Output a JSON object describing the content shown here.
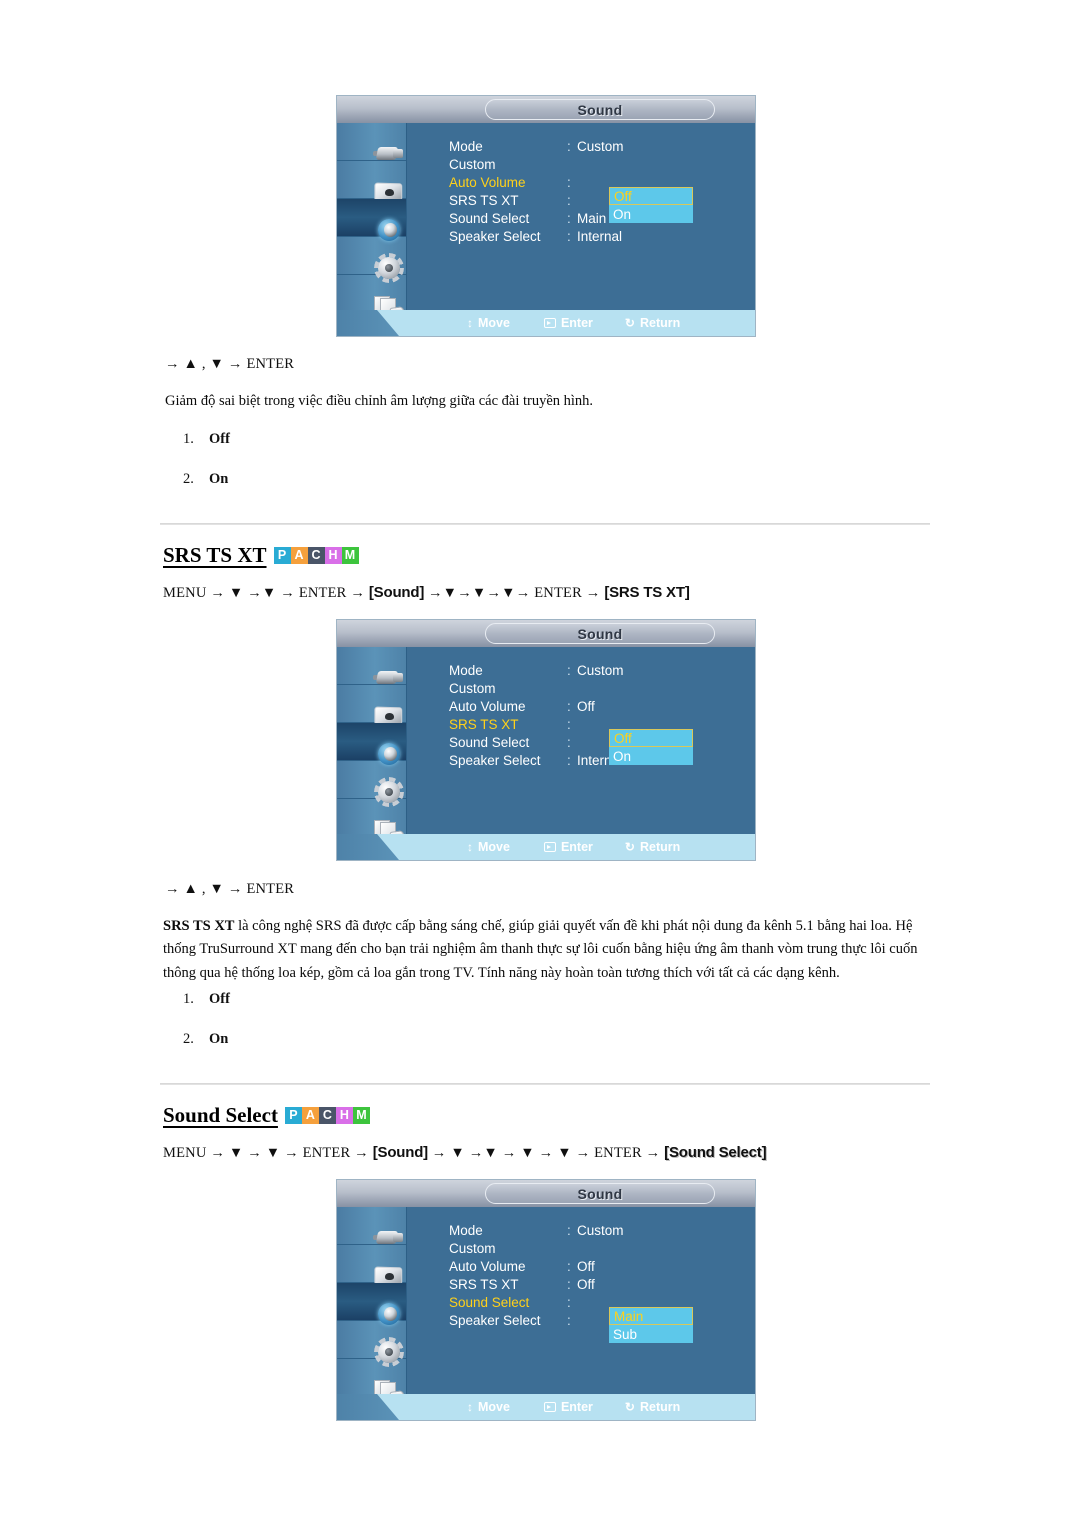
{
  "sections": [
    {
      "nav_after": "→ ▲ , ▼ → ENTER",
      "description": "Giảm độ sai biệt trong việc điều chỉnh âm lượng giữa các đài truyền hình.",
      "options": [
        {
          "num": "1.",
          "value": "Off"
        },
        {
          "num": "2.",
          "value": "On"
        }
      ]
    }
  ],
  "headings": {
    "srs": "SRS TS XT",
    "sound_select": "Sound Select"
  },
  "badges": [
    {
      "letter": "P",
      "color": "#29abd4"
    },
    {
      "letter": "A",
      "color": "#f5a03c"
    },
    {
      "letter": "C",
      "color": "#4a5568"
    },
    {
      "letter": "H",
      "color": "#d96fe8"
    },
    {
      "letter": "M",
      "color": "#3dc43d"
    }
  ],
  "paths": {
    "srs": {
      "prefix": "MENU → ▼ →▼ → ENTER → ",
      "token1": "[Sound]",
      "middle": " →▼→▼→▼→ ENTER → ",
      "token2": "[SRS TS XT]"
    },
    "sound_select": {
      "prefix": "MENU → ▼ → ▼ → ENTER → ",
      "token1": "[Sound]",
      "middle": " → ▼ →▼ → ▼ → ▼ → ENTER → ",
      "token2": "[Sound Select]"
    }
  },
  "nav_enter": "→ ▲ , ▼ → ENTER",
  "srs_description": "SRS TS XT là công nghệ SRS đã được cấp bằng sáng chế, giúp giải quyết vấn đề khi phát nội dung đa kênh 5.1 bằng hai loa. Hệ thống TruSurround XT mang đến cho bạn trải nghiệm âm thanh thực sự lôi cuốn bằng hiệu ứng âm thanh vòm trung thực lôi cuốn thông qua hệ thống loa kép, gồm cả loa gắn trong TV. Tính năng này hoàn toàn tương thích với tất cả các dạng kênh.",
  "srs_description_bold": "SRS TS XT",
  "srs_options": [
    {
      "num": "1.",
      "value": "Off"
    },
    {
      "num": "2.",
      "value": "On"
    }
  ],
  "osd": {
    "title": "Sound",
    "sidebar_icons": [
      {
        "name": "input-source-icon"
      },
      {
        "name": "picture-icon"
      },
      {
        "name": "sound-icon"
      },
      {
        "name": "setup-gear-icon"
      },
      {
        "name": "multi-control-icon"
      }
    ],
    "footer": {
      "move": "Move",
      "enter": "Enter",
      "return": "Return"
    },
    "colors": {
      "panel_blue": "#3d6e95",
      "highlight_cyan": "#5dc8ea",
      "active_yellow": "#ffd11a",
      "footer_blue": "#b7e1f1"
    },
    "screens": [
      {
        "id": "auto-volume",
        "rows": [
          {
            "label": "Mode",
            "colon": ":",
            "value": "Custom",
            "active": false
          },
          {
            "label": "Custom",
            "colon": "",
            "value": "",
            "active": false
          },
          {
            "label": "Auto Volume",
            "colon": ":",
            "value": "",
            "active": true
          },
          {
            "label": "SRS TS XT",
            "colon": ":",
            "value": "",
            "active": false
          },
          {
            "label": "Sound Select",
            "colon": ":",
            "value": "Main",
            "active": false
          },
          {
            "label": "Speaker Select",
            "colon": ":",
            "value": "Internal",
            "active": false
          }
        ],
        "highlight": {
          "top_row": 2,
          "options": [
            "Off",
            "On"
          ],
          "current": 0
        }
      },
      {
        "id": "srs-ts-xt",
        "rows": [
          {
            "label": "Mode",
            "colon": ":",
            "value": "Custom",
            "active": false
          },
          {
            "label": "Custom",
            "colon": "",
            "value": "",
            "active": false
          },
          {
            "label": "Auto Volume",
            "colon": ":",
            "value": "Off",
            "active": false
          },
          {
            "label": "SRS TS XT",
            "colon": ":",
            "value": "",
            "active": true
          },
          {
            "label": "Sound Select",
            "colon": ":",
            "value": "",
            "active": false
          },
          {
            "label": "Speaker Select",
            "colon": ":",
            "value": "Internal",
            "active": false
          }
        ],
        "highlight": {
          "top_row": 3,
          "options": [
            "Off",
            "On"
          ],
          "current": 0
        }
      },
      {
        "id": "sound-select",
        "rows": [
          {
            "label": "Mode",
            "colon": ":",
            "value": "Custom",
            "active": false
          },
          {
            "label": "Custom",
            "colon": "",
            "value": "",
            "active": false
          },
          {
            "label": "Auto Volume",
            "colon": ":",
            "value": "Off",
            "active": false
          },
          {
            "label": "SRS TS XT",
            "colon": ":",
            "value": "Off",
            "active": false
          },
          {
            "label": "Sound Select",
            "colon": ":",
            "value": "",
            "active": true
          },
          {
            "label": "Speaker Select",
            "colon": ":",
            "value": "",
            "active": false
          }
        ],
        "highlight": {
          "top_row": 4,
          "options": [
            "Main",
            "Sub"
          ],
          "current": 0
        }
      }
    ]
  }
}
